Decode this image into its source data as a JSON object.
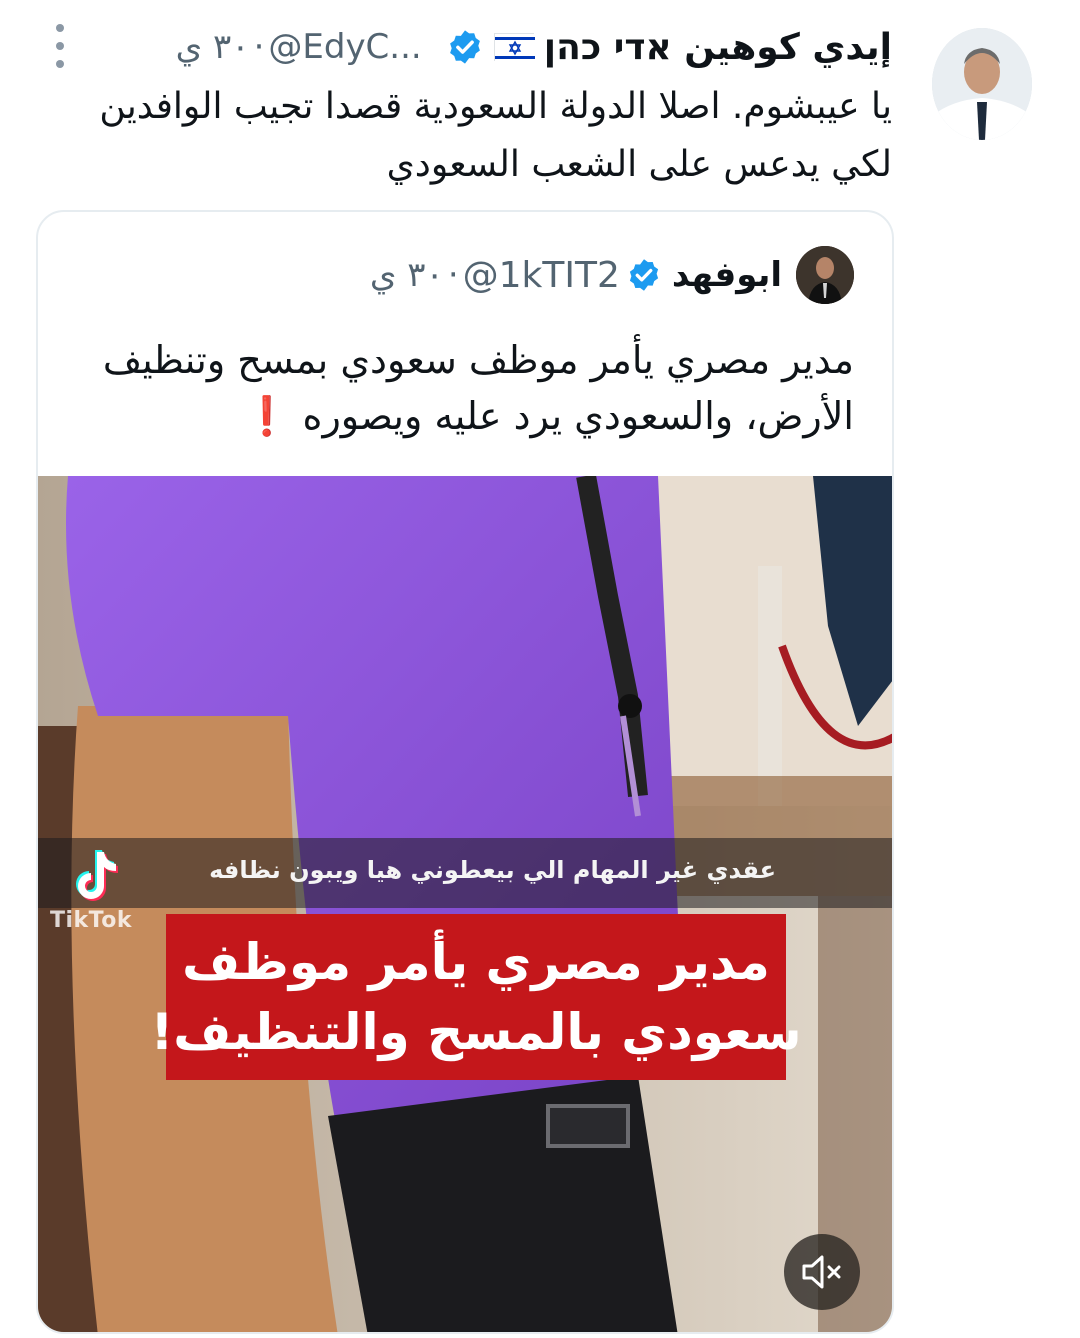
{
  "tweet": {
    "author_name": "إيدي كوهين אדי כהן",
    "flag": "🇮🇱",
    "flag_name": "israel-flag-icon",
    "handle": "@EdyC...",
    "separator": "·",
    "time": "٣٠ ي",
    "text": "يا عيبشوم. اصلا الدولة السعودية قصدا تجيب الوافدين لكي يدعس على الشعب السعودي"
  },
  "quoted_tweet": {
    "author_name": "ابوفهد",
    "handle": "@1kTIT2",
    "separator": "·",
    "time": "٣٠ ي",
    "text": "مدير مصري يأمر موظف سعودي بمسح وتنظيف الأرض، والسعودي يرد عليه ويصوره",
    "emoji": "❗"
  },
  "media": {
    "caption_small": "عقدي غير المهام الي بيعطوني هيا ويبون نظافه",
    "watermark": "TikTok",
    "banner_line1": "مدير مصري يأمر موظف",
    "banner_line2": "سعودي بالمسح والتنظيف!"
  },
  "colors": {
    "verified": "#1d9bf0",
    "secondary_text": "#536471",
    "banner_red": "#c4171b",
    "shirt_purple": "#8a4fd6"
  }
}
